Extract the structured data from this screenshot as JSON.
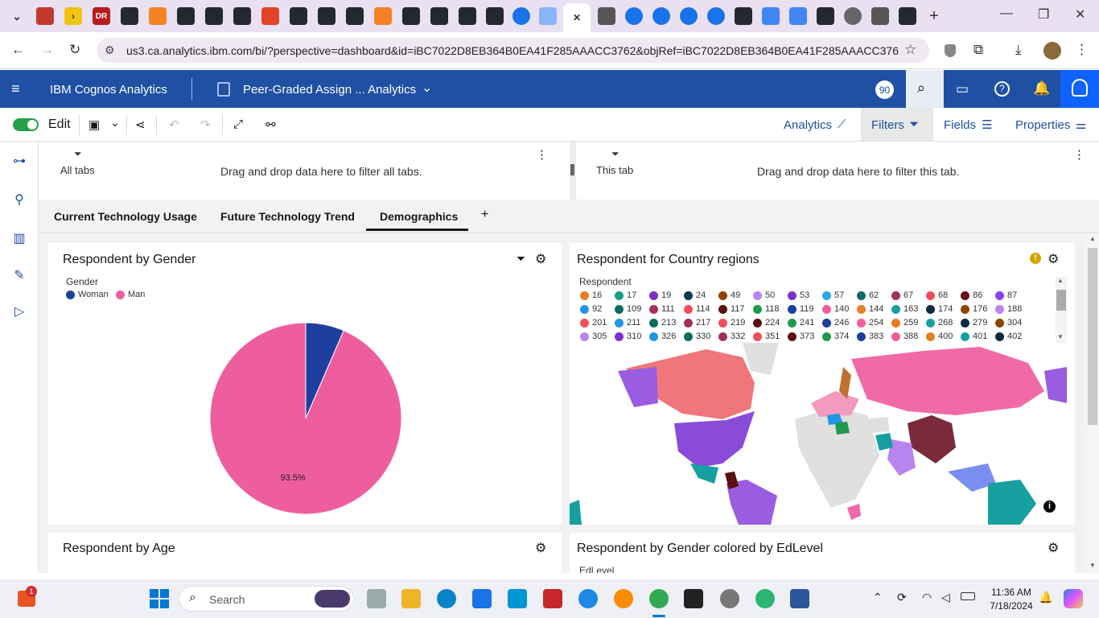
{
  "browser": {
    "url": "us3.ca.analytics.ibm.com/bi/?perspective=dashboard&id=iBC7022D8EB364B0EA41F285AAACC3762&objRef=iBC7022D8EB364B0EA41F285AAACC3762&o..."
  },
  "app": {
    "product": "IBM Cognos Analytics",
    "dashboard_title": "Peer-Graded Assign ... Analytics",
    "badge": "90",
    "edit_label": "Edit",
    "analytics_label": "Analytics",
    "filters_label": "Filters",
    "fields_label": "Fields",
    "properties_label": "Properties"
  },
  "filters": {
    "all_tabs_label": "All tabs",
    "all_tabs_hint": "Drag and drop data here to filter all tabs.",
    "this_tab_label": "This tab",
    "this_tab_hint": "Drag and drop data here to filter this tab."
  },
  "tabs": [
    "Current Technology Usage",
    "Future Technology Trend",
    "Demographics"
  ],
  "cards": {
    "gender": {
      "title": "Respondent by Gender",
      "legend_title": "Gender",
      "legend": [
        {
          "label": "Woman",
          "color": "#1f3f9f"
        },
        {
          "label": "Man",
          "color": "#ee5e9e"
        }
      ]
    },
    "country": {
      "title": "Respondent for Country regions",
      "legend_title": "Respondent",
      "legend": [
        {
          "label": "16",
          "color": "#e67e22"
        },
        {
          "label": "17",
          "color": "#16a085"
        },
        {
          "label": "19",
          "color": "#7d2fc9"
        },
        {
          "label": "24",
          "color": "#0b3b4f"
        },
        {
          "label": "49",
          "color": "#8e4400"
        },
        {
          "label": "50",
          "color": "#b784f0"
        },
        {
          "label": "53",
          "color": "#7d2fc9"
        },
        {
          "label": "57",
          "color": "#2aa6e8"
        },
        {
          "label": "62",
          "color": "#0e6b5f"
        },
        {
          "label": "67",
          "color": "#a2305e"
        },
        {
          "label": "68",
          "color": "#f04e58"
        },
        {
          "label": "86",
          "color": "#6b0f1a"
        },
        {
          "label": "87",
          "color": "#8a3ff0"
        },
        {
          "label": "92",
          "color": "#2196e8"
        },
        {
          "label": "109",
          "color": "#0e6b5f"
        },
        {
          "label": "111",
          "color": "#a2305e"
        },
        {
          "label": "114",
          "color": "#f04e58"
        },
        {
          "label": "117",
          "color": "#5a0f10"
        },
        {
          "label": "118",
          "color": "#1f9a4a"
        },
        {
          "label": "119",
          "color": "#1a3fa0"
        },
        {
          "label": "140",
          "color": "#ee5e9e"
        },
        {
          "label": "144",
          "color": "#e67e22"
        },
        {
          "label": "163",
          "color": "#16a0a0"
        },
        {
          "label": "174",
          "color": "#0b2b3f"
        },
        {
          "label": "176",
          "color": "#8e4400"
        },
        {
          "label": "188",
          "color": "#b784f0"
        },
        {
          "label": "201",
          "color": "#f04e58"
        },
        {
          "label": "211",
          "color": "#2196e8"
        },
        {
          "label": "213",
          "color": "#0e6b5f"
        },
        {
          "label": "217",
          "color": "#a2305e"
        },
        {
          "label": "219",
          "color": "#f04e58"
        },
        {
          "label": "224",
          "color": "#5a0f10"
        },
        {
          "label": "241",
          "color": "#1f9a4a"
        },
        {
          "label": "246",
          "color": "#1a3fa0"
        },
        {
          "label": "254",
          "color": "#ee5e9e"
        },
        {
          "label": "259",
          "color": "#e67e22"
        },
        {
          "label": "268",
          "color": "#16a0a0"
        },
        {
          "label": "279",
          "color": "#0b2b3f"
        },
        {
          "label": "304",
          "color": "#8e4400"
        },
        {
          "label": "305",
          "color": "#b784f0"
        },
        {
          "label": "310",
          "color": "#7d2fc9"
        },
        {
          "label": "326",
          "color": "#2196e8"
        },
        {
          "label": "330",
          "color": "#0e6b5f"
        },
        {
          "label": "332",
          "color": "#a2305e"
        },
        {
          "label": "351",
          "color": "#f04e58"
        },
        {
          "label": "373",
          "color": "#5a0f10"
        },
        {
          "label": "374",
          "color": "#1f9a4a"
        },
        {
          "label": "383",
          "color": "#1a3fa0"
        },
        {
          "label": "388",
          "color": "#ee5e9e"
        },
        {
          "label": "400",
          "color": "#e67e22"
        },
        {
          "label": "401",
          "color": "#16a0a0"
        },
        {
          "label": "402",
          "color": "#0b2b3f"
        }
      ]
    },
    "age": {
      "title": "Respondent by Age"
    },
    "edlevel": {
      "title": "Respondent by Gender colored by EdLevel",
      "legend_title": "EdLevel"
    }
  },
  "chart_data": {
    "type": "pie",
    "title": "Respondent by Gender",
    "categories": [
      "Woman",
      "Man"
    ],
    "values": [
      6.5,
      93.5
    ],
    "data_labels": [
      "",
      "93.5%"
    ],
    "legend": "top-left"
  },
  "taskbar": {
    "search_placeholder": "Search",
    "time": "11:36 AM",
    "date": "7/18/2024",
    "notification_badge": "1"
  }
}
